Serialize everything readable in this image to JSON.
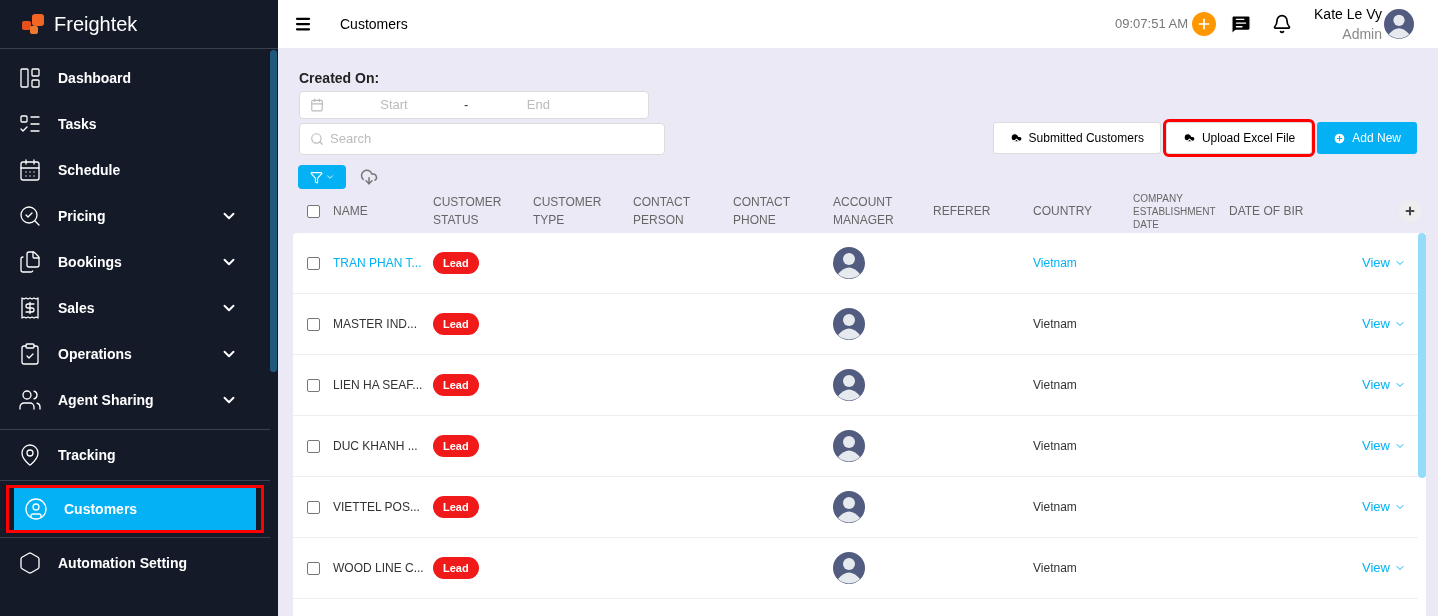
{
  "brand": "Freightek",
  "sidebar": {
    "groups": [
      [
        {
          "label": "Dashboard",
          "has_submenu": false,
          "selected": false
        },
        {
          "label": "Tasks",
          "has_submenu": false,
          "selected": false
        },
        {
          "label": "Schedule",
          "has_submenu": false,
          "selected": false
        },
        {
          "label": "Pricing",
          "has_submenu": true,
          "selected": false
        },
        {
          "label": "Bookings",
          "has_submenu": true,
          "selected": false
        },
        {
          "label": "Sales",
          "has_submenu": true,
          "selected": false
        },
        {
          "label": "Operations",
          "has_submenu": true,
          "selected": false
        },
        {
          "label": "Agent Sharing",
          "has_submenu": true,
          "selected": false
        }
      ],
      [
        {
          "label": "Tracking",
          "has_submenu": false,
          "selected": false
        }
      ],
      [
        {
          "label": "Customers",
          "has_submenu": false,
          "selected": true,
          "highlighted": true
        }
      ],
      [
        {
          "label": "Automation Setting",
          "has_submenu": false,
          "selected": false
        }
      ]
    ]
  },
  "topbar": {
    "title": "Customers",
    "time": "09:07:51 AM",
    "user_name": "Kate Le Vy",
    "user_role": "Admin"
  },
  "filters": {
    "label": "Created On:",
    "start_placeholder": "Start",
    "separator": "-",
    "end_placeholder": "End",
    "search_placeholder": "Search"
  },
  "actions": [
    {
      "label": "Submitted Customers",
      "kind": "upload",
      "highlighted": false
    },
    {
      "label": "Upload Excel File",
      "kind": "upload",
      "highlighted": true
    },
    {
      "label": "Add New",
      "kind": "primary",
      "highlighted": false
    }
  ],
  "table": {
    "header_checked": false,
    "columns": [
      "NAME",
      "CUSTOMER STATUS",
      "CUSTOMER TYPE",
      "CONTACT PERSON",
      "CONTACT PHONE",
      "ACCOUNT MANAGER",
      "REFERER",
      "COUNTRY",
      "COMPANY ESTABLISHMENT DATE",
      "DATE OF BIR"
    ],
    "rows": [
      {
        "name": "TRAN PHAN T...",
        "status": "Lead",
        "country": "Vietnam",
        "action": "View",
        "checked": false,
        "selected": true
      },
      {
        "name": "MASTER IND...",
        "status": "Lead",
        "country": "Vietnam",
        "action": "View",
        "checked": false,
        "selected": false
      },
      {
        "name": "LIEN HA SEAF...",
        "status": "Lead",
        "country": "Vietnam",
        "action": "View",
        "checked": false,
        "selected": false
      },
      {
        "name": "DUC KHANH ...",
        "status": "Lead",
        "country": "Vietnam",
        "action": "View",
        "checked": false,
        "selected": false
      },
      {
        "name": "VIETTEL POS...",
        "status": "Lead",
        "country": "Vietnam",
        "action": "View",
        "checked": false,
        "selected": false
      },
      {
        "name": "WOOD LINE C...",
        "status": "Lead",
        "country": "Vietnam",
        "action": "View",
        "checked": false,
        "selected": false
      }
    ]
  }
}
